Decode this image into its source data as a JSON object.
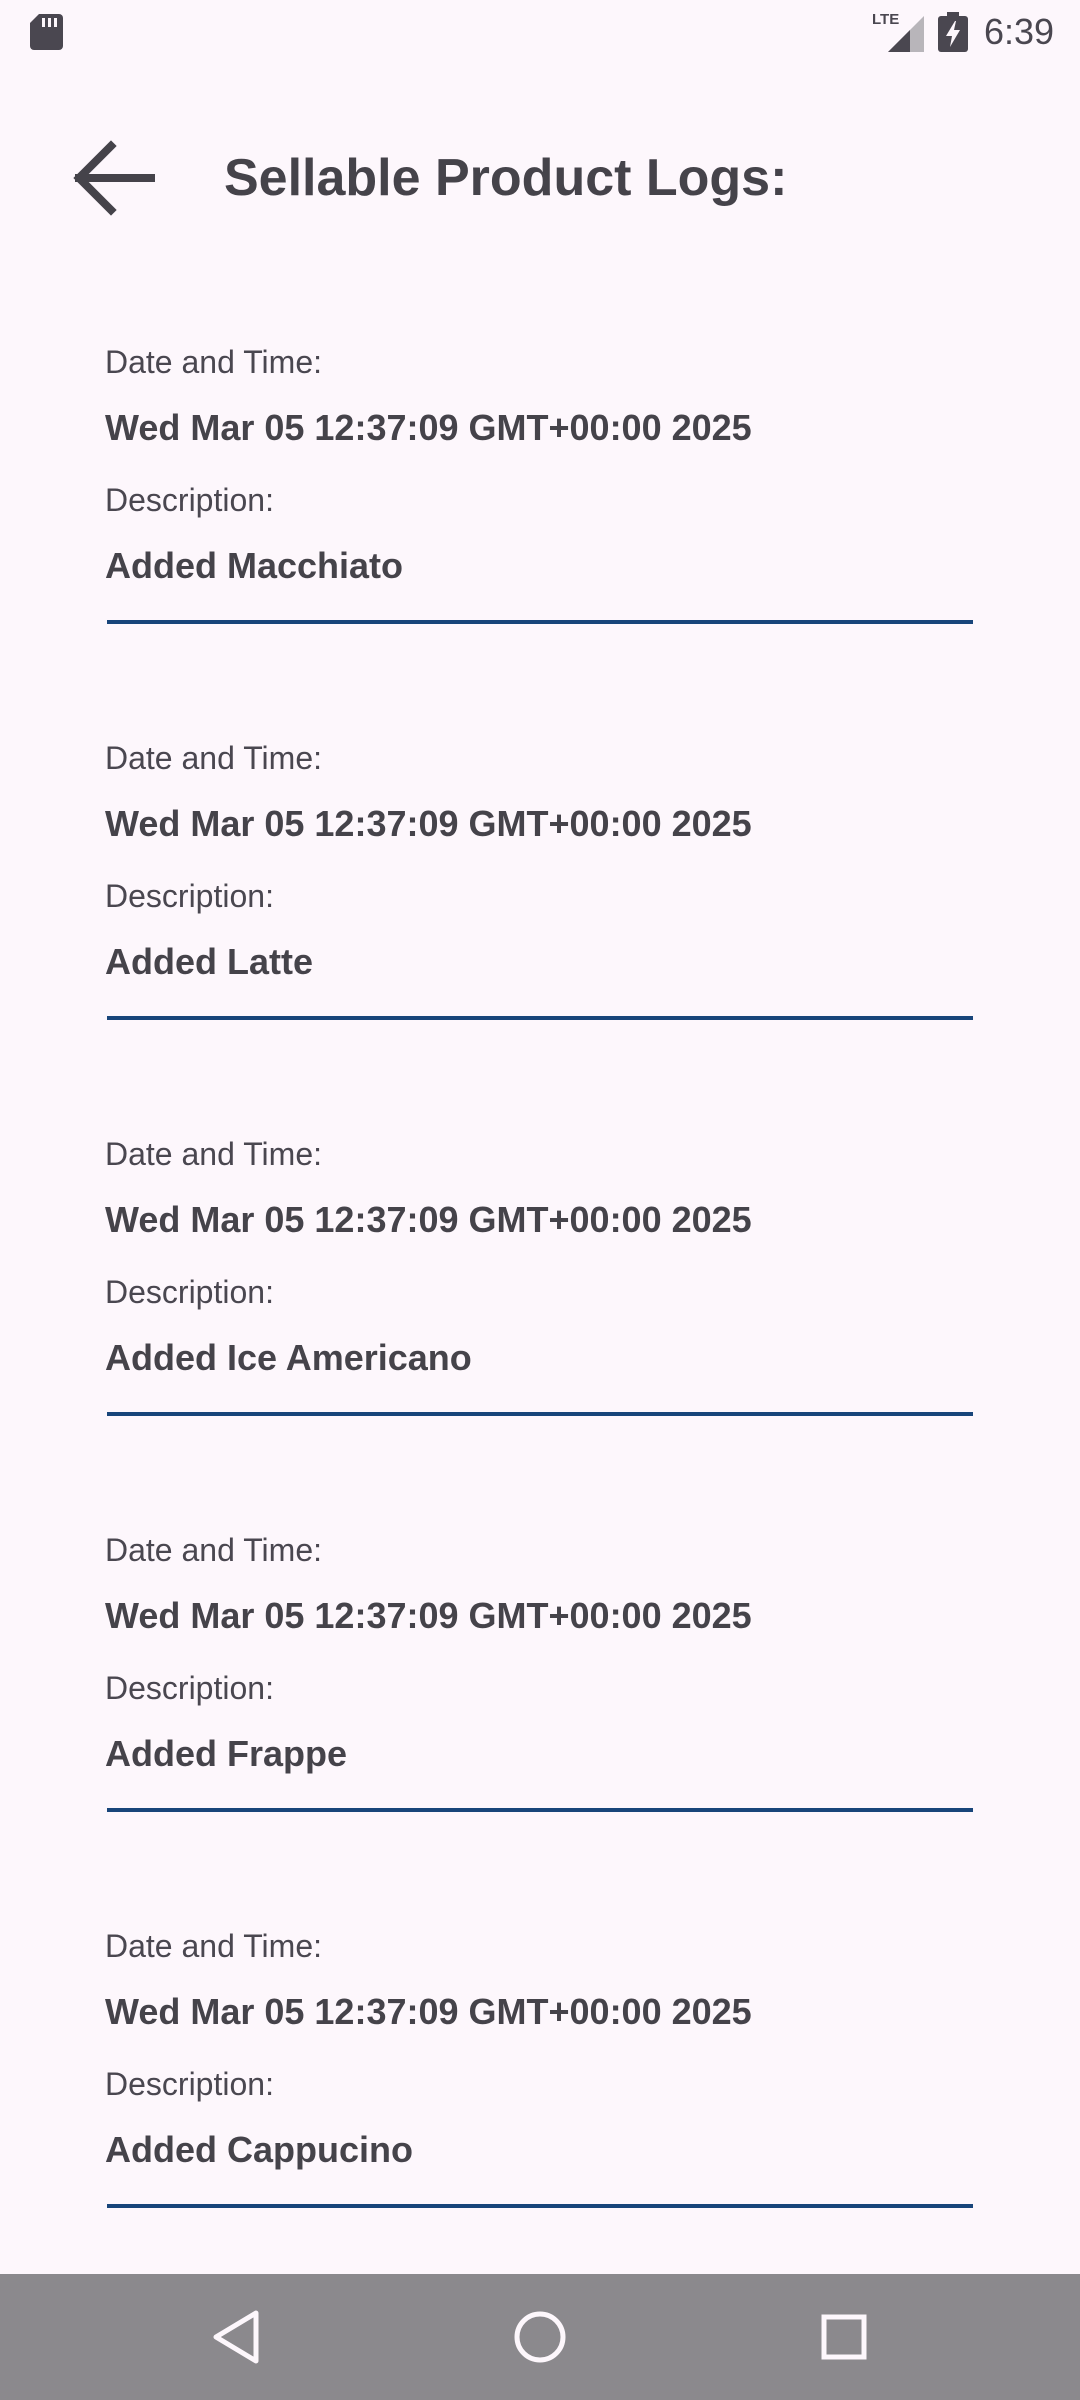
{
  "status_bar": {
    "time": "6:39",
    "network_label": "LTE",
    "icons": [
      "sd-card-icon",
      "lte-signal-icon",
      "battery-charging-icon"
    ]
  },
  "header": {
    "title": "Sellable Product Logs:",
    "back_icon": "arrow-left-icon"
  },
  "logs": [
    {
      "date_label": "Date and Time:",
      "date_value": "Wed Mar 05 12:37:09 GMT+00:00 2025",
      "description_label": "Description:",
      "description_value": "Added Macchiato"
    },
    {
      "date_label": "Date and Time:",
      "date_value": "Wed Mar 05 12:37:09 GMT+00:00 2025",
      "description_label": "Description:",
      "description_value": "Added Latte"
    },
    {
      "date_label": "Date and Time:",
      "date_value": "Wed Mar 05 12:37:09 GMT+00:00 2025",
      "description_label": "Description:",
      "description_value": "Added Ice Americano"
    },
    {
      "date_label": "Date and Time:",
      "date_value": "Wed Mar 05 12:37:09 GMT+00:00 2025",
      "description_label": "Description:",
      "description_value": "Added Frappe"
    },
    {
      "date_label": "Date and Time:",
      "date_value": "Wed Mar 05 12:37:09 GMT+00:00 2025",
      "description_label": "Description:",
      "description_value": "Added Cappucino"
    }
  ],
  "nav_bar": {
    "icons": [
      "nav-back-icon",
      "nav-home-icon",
      "nav-recents-icon"
    ]
  },
  "colors": {
    "background": "#fdf7fc",
    "text": "#45434a",
    "divider": "#18457a",
    "nav_bar": "#8b898d"
  }
}
